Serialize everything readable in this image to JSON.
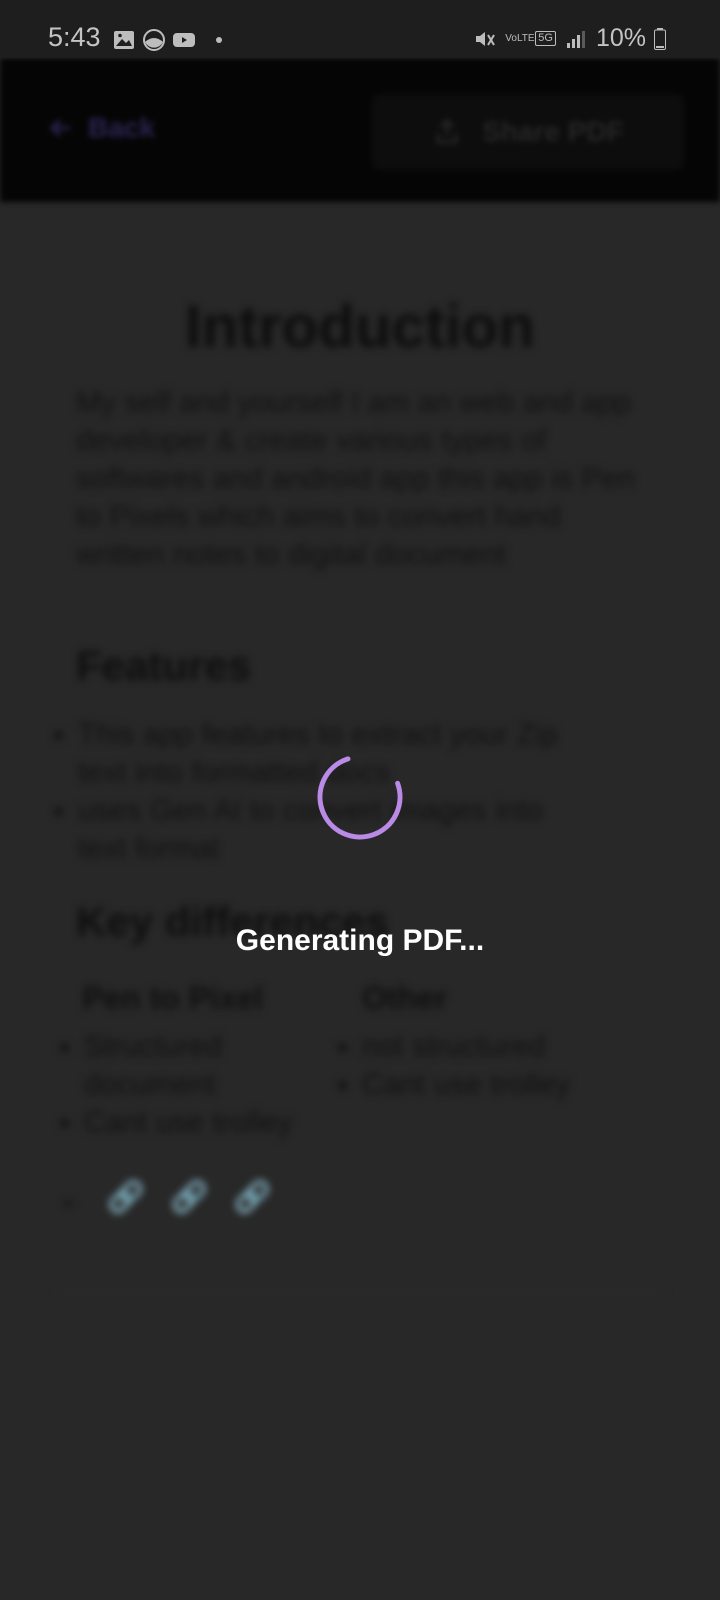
{
  "status_bar": {
    "time": "5:43",
    "network_type": "VoLTE",
    "network_gen": "5G",
    "battery_percent": "10%",
    "icons": [
      "gallery-icon",
      "app-icon",
      "youtube-icon",
      "notification-dot",
      "mute-icon",
      "volte-icon",
      "5g-icon",
      "signal-icon",
      "battery-icon"
    ]
  },
  "toolbar": {
    "back_label": "Back",
    "share_label": "Share PDF"
  },
  "document": {
    "title": "Introduction",
    "paragraph": "My self and yourself I am an web and app developer & create various types of softwares and android app this app is Pen to Pixels which aims to convert hand written notes to digital document",
    "features_heading": "Features",
    "features": [
      "This app features to extract your Zip text into formatted docs",
      "uses Gen AI to convert images into text format"
    ],
    "key_diff_heading": "Key differences",
    "columns": [
      {
        "heading": "Pen to Pixel",
        "items": [
          "Structured document",
          "Cant use trolley"
        ]
      },
      {
        "heading": "Other",
        "items": [
          "not structured",
          "Cant use trolley"
        ]
      }
    ]
  },
  "loading": {
    "message": "Generating PDF...",
    "spinner_color": "#b98ae6"
  },
  "colors": {
    "background": "#282828",
    "toolbar": "#050505",
    "accent": "#b98ae6"
  }
}
